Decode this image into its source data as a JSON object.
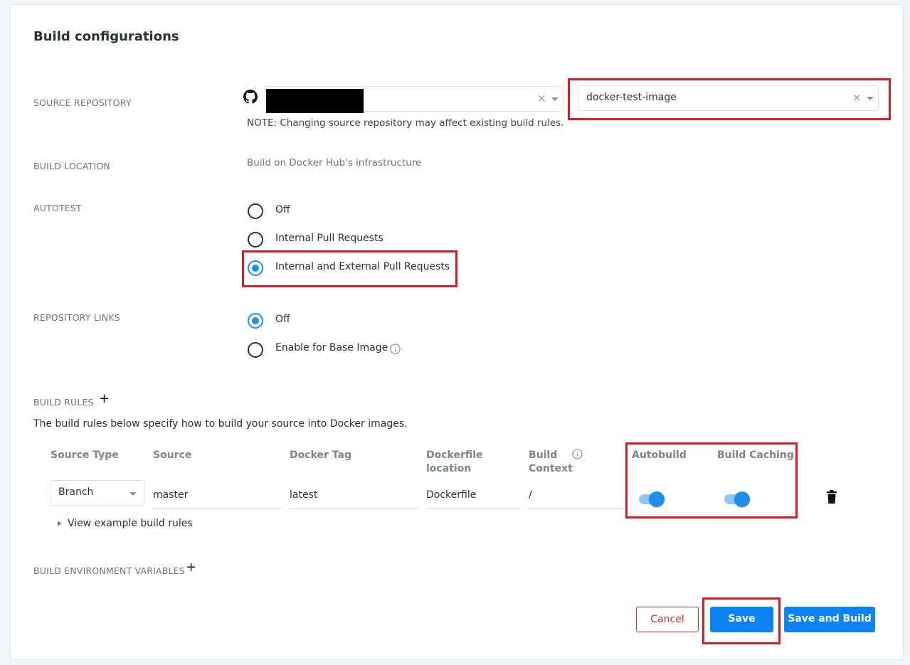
{
  "title": "Build configurations",
  "source_repository": {
    "label": "SOURCE REPOSITORY",
    "repo_value": "docker-test-image",
    "clear_glyph": "×",
    "note": "NOTE: Changing source repository may affect existing build rules."
  },
  "build_location": {
    "label": "BUILD LOCATION",
    "value": "Build on Docker Hub's infrastructure"
  },
  "autotest": {
    "label": "AUTOTEST",
    "options": [
      "Off",
      "Internal Pull Requests",
      "Internal and External Pull Requests"
    ],
    "selected": "Internal and External Pull Requests"
  },
  "repository_links": {
    "label": "REPOSITORY LINKS",
    "options": [
      "Off",
      "Enable for Base Image"
    ],
    "selected": "Off"
  },
  "build_rules": {
    "label": "BUILD RULES",
    "add_glyph": "+",
    "description": "The build rules below specify how to build your source into Docker images.",
    "columns": {
      "source_type": "Source Type",
      "source": "Source",
      "docker_tag": "Docker Tag",
      "dockerfile_location": [
        "Dockerfile",
        "location"
      ],
      "build_context": [
        "Build",
        "Context"
      ],
      "autobuild": "Autobuild",
      "build_caching": "Build Caching"
    },
    "row": {
      "source_type": "Branch",
      "source": "master",
      "docker_tag": "latest",
      "dockerfile_location": "Dockerfile",
      "build_context": "/",
      "autobuild": true,
      "build_caching": true
    },
    "view_examples": "View example build rules"
  },
  "build_env": {
    "label": "BUILD ENVIRONMENT VARIABLES",
    "add_glyph": "+"
  },
  "buttons": {
    "cancel": "Cancel",
    "save": "Save",
    "save_and_build": "Save and Build"
  },
  "colors": {
    "accent": "#1d8fe6",
    "primary_button": "#0b83f4",
    "highlight": "#d0202a",
    "cancel": "#c0392b"
  },
  "icons": [
    "github-icon",
    "clear-icon",
    "chevron-down-icon",
    "info-icon",
    "plus-icon",
    "triangle-right-icon",
    "trash-icon"
  ]
}
